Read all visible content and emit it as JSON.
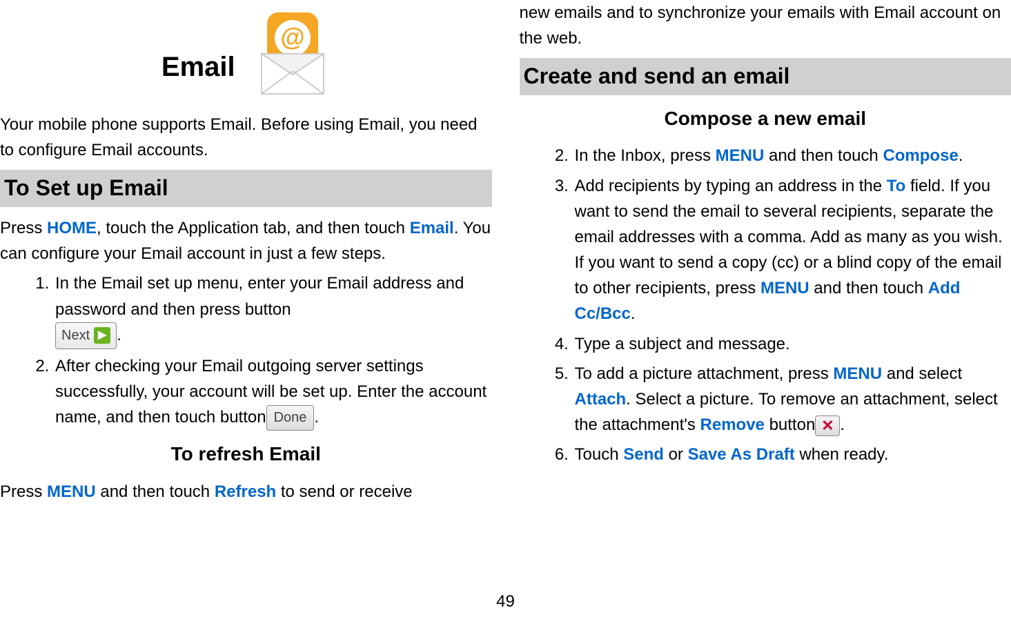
{
  "page_number": "49",
  "left": {
    "title": "Email",
    "intro": "Your mobile phone supports Email. Before using Email, you need to configure Email accounts.",
    "setup_heading": "To Set up Email",
    "setup_para_pre": "Press ",
    "setup_para_home": "HOME",
    "setup_para_mid": ", touch the Application tab, and then touch ",
    "setup_para_email": "Email",
    "setup_para_post": ". You can configure your Email account in just a few steps.",
    "setup_item1": "In the Email set up menu, enter your Email address and password and then press button",
    "next_label": "Next",
    "setup_item2_pre": "After checking your Email outgoing server settings successfully, your account will be set up. Enter the account name, and then touch button",
    "done_label": "Done",
    "refresh_heading": "To refresh Email",
    "refresh_pre": "Press ",
    "refresh_menu": "MENU",
    "refresh_mid": " and then touch ",
    "refresh_refresh": "Refresh",
    "refresh_post": " to send or receive"
  },
  "right": {
    "continuation": "new emails and to synchronize your emails with Email account on the web.",
    "create_heading": "Create and send an email",
    "compose_heading": "Compose a new email",
    "item2_pre": "In the Inbox, press ",
    "item2_menu": "MENU",
    "item2_mid": " and then touch ",
    "item2_compose": "Compose",
    "item3_pre": "Add recipients by typing an address in the ",
    "item3_to": "To",
    "item3_mid": " field. If you want to send the email to several recipients, separate the email addresses with a comma. Add as many as you wish.",
    "item3b_pre": "If you want to send a copy (cc) or a blind copy of the email to other recipients, press ",
    "item3b_menu": "MENU",
    "item3b_mid": " and then touch ",
    "item3b_ccbcc": "Add Cc/Bcc",
    "item4": "Type a subject and message.",
    "item5_pre": "To add a picture attachment, press ",
    "item5_menu": "MENU",
    "item5_mid": " and select ",
    "item5_attach": "Attach",
    "item5_mid2": ". Select a picture. To remove an attachment, select the attachment's ",
    "item5_remove": "Remove",
    "item5_post": " button",
    "item6_pre": "Touch ",
    "item6_send": "Send",
    "item6_mid": " or ",
    "item6_save": "Save As Draft",
    "item6_post": " when ready."
  }
}
